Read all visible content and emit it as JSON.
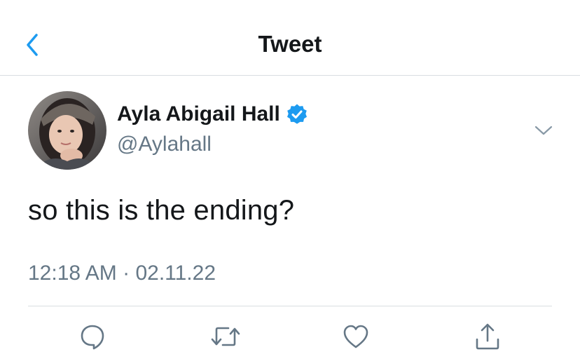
{
  "header": {
    "title": "Tweet",
    "back_icon": "chevron-left-icon"
  },
  "tweet": {
    "author": {
      "display_name": "Ayla Abigail Hall",
      "handle": "@Aylahall",
      "verified": true
    },
    "text": "so this is the ending?",
    "time": "12:18 AM",
    "separator": "·",
    "date": "02.11.22"
  },
  "actions": [
    {
      "name": "reply",
      "icon": "reply-icon"
    },
    {
      "name": "retweet",
      "icon": "retweet-icon"
    },
    {
      "name": "like",
      "icon": "heart-icon"
    },
    {
      "name": "share",
      "icon": "share-icon"
    }
  ],
  "colors": {
    "accent": "#1d9bf0",
    "text": "#14171a",
    "secondary": "#657786",
    "divider": "#d9dde1"
  }
}
